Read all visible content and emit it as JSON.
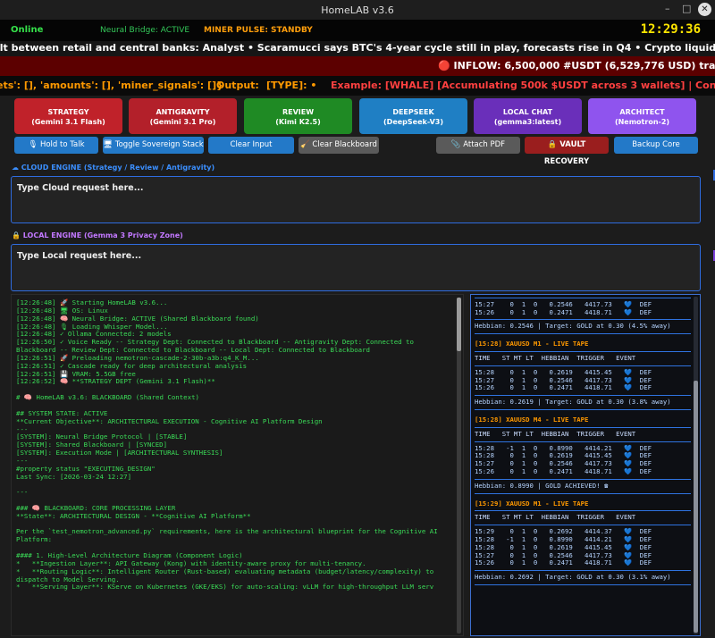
{
  "window": {
    "title": "HomeLAB v3.6",
    "minimize": "–",
    "maximize": "□",
    "close": "✕"
  },
  "status": {
    "online": "Online",
    "bridge": "Neural Bridge: ACTIVE",
    "miner": "MINER PULSE: STANDBY",
    "clock": "12:29:36"
  },
  "tickers": {
    "news": "ilt between retail and central banks: Analyst   •   Scaramucci says BTC's 4-year cycle still in play, forecasts rise in Q4   •   Crypto liquidations nea",
    "inflow": "🔴 INFLOW: 6,500,000 #USDT (6,529,776 USD) transferre",
    "signal_1": "ets': [], 'amounts': [], 'miner_signals': []}",
    "signal_2": "Output:",
    "signal_3": "[TYPE]:  •",
    "signal_4": "Example: [WHALE] [Accumulating 500k $USDT across 3 wallets] | Confidence: 0"
  },
  "departments": [
    {
      "name": "STRATEGY",
      "model": "(Gemini 3.1 Flash)",
      "color": "#c0222a"
    },
    {
      "name": "ANTIGRAVITY",
      "model": "(Gemini 3.1 Pro)",
      "color": "#b3202a"
    },
    {
      "name": "REVIEW",
      "model": "(Kimi K2.5)",
      "color": "#1f8a24"
    },
    {
      "name": "DEEPSEEK",
      "model": "(DeepSeek-V3)",
      "color": "#1f7fc4"
    },
    {
      "name": "LOCAL CHAT",
      "model": "(gemma3:latest)",
      "color": "#6a2fba"
    },
    {
      "name": "ARCHITECT",
      "model": "(Nemotron-2)",
      "color": "#8f54ee"
    }
  ],
  "actions": {
    "hold_to_talk": "🎙 Hold to Talk",
    "toggle_stack": "🖥 Toggle Sovereign Stack",
    "clear_input": "Clear Input",
    "clear_blackboard": "🧹 Clear Blackboard",
    "attach_pdf": "📎 Attach PDF",
    "vault_recovery": "🔒 VAULT RECOVERY",
    "backup_core": "Backup Core"
  },
  "cloud": {
    "label": "☁ CLOUD ENGINE (Strategy / Review / Antigravity)",
    "placeholder": "Type Cloud request here..."
  },
  "local": {
    "label": "🔒 LOCAL ENGINE (Gemma 3 Privacy Zone)",
    "placeholder": "Type Local request here..."
  },
  "log": [
    "[12:26:48] 🚀 Starting HomeLAB v3.6...",
    "[12:26:48] 🖥 OS: Linux",
    "[12:26:48] 🧠 Neural Bridge: ACTIVE (Shared Blackboard found)",
    "[12:26:48] 🎙 Loading Whisper Model...",
    "[12:26:48] ✓ Ollama Connected: 2 models",
    "[12:26:50] ✓ Voice Ready -- Strategy Dept: Connected to Blackboard -- Antigravity Dept: Connected to Blackboard -- Review Dept: Connected to Blackboard -- Local Dept: Connected to Blackboard",
    "[12:26:51] 🚀 Preloading nemotron-cascade-2-30b-a3b:q4_K_M...",
    "[12:26:51] ✓ Cascade ready for deep architectural analysis",
    "[12:26:51] 💾 VRAM: 5.5GB free",
    "[12:26:52] 🧠 **STRATEGY DEPT (Gemini 3.1 Flash)**",
    "",
    "# 🧠 HomeLAB v3.6: BLACKBOARD (Shared Context)",
    "",
    "## SYSTEM STATE: ACTIVE",
    "**Current Objective**: ARCHITECTURAL EXECUTION - Cognitive AI Platform Design",
    "---",
    "[SYSTEM]: Neural Bridge Protocol | [STABLE]",
    "[SYSTEM]: Shared Blackboard | [SYNCED]",
    "[SYSTEM]: Execution Mode | [ARCHITECTURAL SYNTHESIS]",
    "---",
    "#property status \"EXECUTING_DESIGN\"",
    "Last Sync: [2026-03-24 12:27]",
    "",
    "---",
    "",
    "### 🧠 BLACKBOARD: CORE PROCESSING LAYER",
    "**State**: ARCHITECTURAL DESIGN - **Cognitive AI Platform**",
    "",
    "Per the `test_nemotron_advanced.py` requirements, here is the architectural blueprint for the Cognitive AI Platform:",
    "",
    "#### 1. High-Level Architecture Diagram (Component Logic)",
    "*   **Ingestion Layer**: API Gateway (Kong) with identity-aware proxy for multi-tenancy.",
    "*   **Routing Logic**: Intelligent Router (Rust-based) evaluating metadata (budget/latency/complexity) to dispatch to Model Serving.",
    "*   **Serving Layer**: KServe on Kubernetes (GKE/EKS) for auto-scaling: vLLM for high-throughput LLM serv"
  ],
  "tape": {
    "columns": "TIME   ST MT LT  HEBBIAN  TRIGGER   EVENT",
    "blocks": [
      {
        "title": "",
        "rows": [
          "15:27    0  1  0   0.2546   4417.73   💙  DEF",
          "15:26    0  1  0   0.2471   4418.71   💙  DEF"
        ],
        "footer": "Hebbian: 0.2546 | Target: GOLD at 0.30 (4.5% away)"
      },
      {
        "title": "[15:28] XAUUSD M1 - LIVE TAPE",
        "rows": [
          "15:28    0  1  0   0.2619   4415.45   💙  DEF",
          "15:27    0  1  0   0.2546   4417.73   💙  DEF",
          "15:26    0  1  0   0.2471   4418.71   💙  DEF"
        ],
        "footer": "Hebbian: 0.2619 | Target: GOLD at 0.30 (3.8% away)"
      },
      {
        "title": "[15:28] XAUUSD M4 - LIVE TAPE",
        "rows": [
          "15:28   -1  1  0   0.8990   4414.21   💙  DEF",
          "15:28    0  1  0   0.2619   4415.45   💙  DEF",
          "15:27    0  1  0   0.2546   4417.73   💙  DEF",
          "15:26    0  1  0   0.2471   4418.71   💙  DEF"
        ],
        "footer": "Hebbian: 0.8990 | GOLD ACHIEVED! ☎"
      },
      {
        "title": "[15:29] XAUUSD M1 - LIVE TAPE",
        "rows": [
          "15:29    0  1  0   0.2692   4414.37   💙  DEF",
          "15:28   -1  1  0   0.8990   4414.21   💙  DEF",
          "15:28    0  1  0   0.2619   4415.45   💙  DEF",
          "15:27    0  1  0   0.2546   4417.73   💙  DEF",
          "15:26    0  1  0   0.2471   4418.71   💙  DEF"
        ],
        "footer": "Hebbian: 0.2692 | Target: GOLD at 0.30 (3.1% away)"
      }
    ]
  }
}
